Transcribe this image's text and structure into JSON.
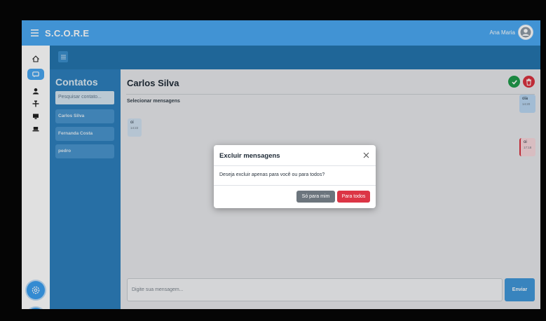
{
  "app": {
    "title": "S.C.O.R.E",
    "user_name": "Ana Maria",
    "brand_color": "#4aa8f2"
  },
  "icons": {
    "menu": "hamburger-icon",
    "avatar": "user-avatar-icon",
    "rail": [
      "home-icon",
      "chat-icon",
      "users-icon",
      "move-icon",
      "monitor-icon",
      "laptop-icon",
      "settings-icon",
      "logout-icon"
    ]
  },
  "contacts": {
    "title": "Contatos",
    "search_placeholder": "Pesquisar contato...",
    "items": [
      {
        "name": "Carlos Silva"
      },
      {
        "name": "Fernanda Costa"
      },
      {
        "name": "pedro"
      }
    ]
  },
  "chat": {
    "contact_name": "Carlos Silva",
    "select_label": "Selecionar mensagens",
    "messages": [
      {
        "text": "ola",
        "time": "14:20",
        "direction": "out"
      },
      {
        "text": "oi",
        "time": "14:22",
        "direction": "in"
      },
      {
        "text": "oi",
        "time": "17:18",
        "direction": "out"
      }
    ],
    "compose_placeholder": "Digite sua mensagem...",
    "send_label": "Enviar"
  },
  "modal": {
    "title": "Excluir mensagens",
    "body": "Deseja excluir apenas para você ou para todos?",
    "btn_me": "Só para mim",
    "btn_all": "Para todos"
  }
}
